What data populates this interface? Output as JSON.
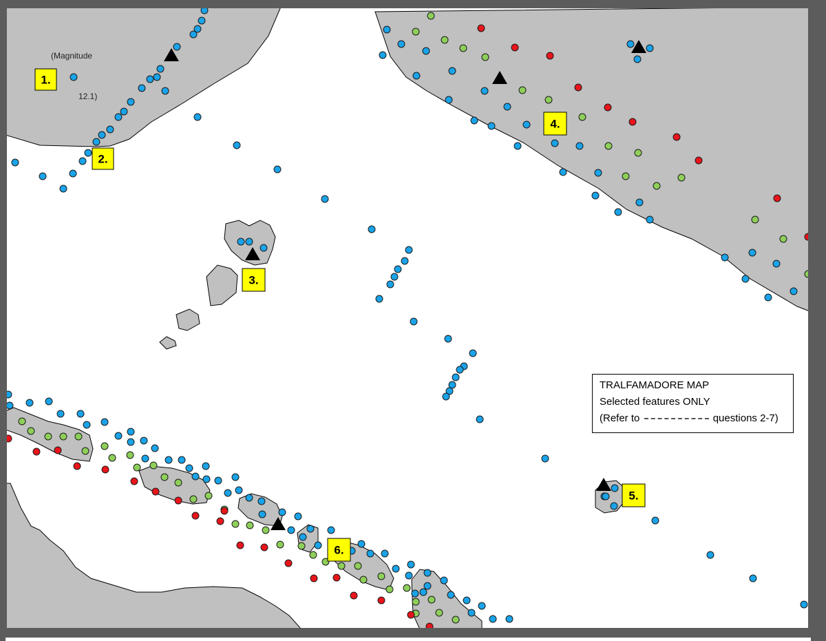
{
  "map": {
    "legend": {
      "title": "TRALFAMADORE MAP",
      "subtitle": "Selected features ONLY",
      "note_prefix": "(Refer to",
      "note_suffix": "questions 2-7)"
    },
    "magnitude_note": {
      "line1": "(Magnitude",
      "line2": "12.1)"
    },
    "labels": [
      "1.",
      "2.",
      "3.",
      "4.",
      "5.",
      "6."
    ],
    "colors": {
      "land": "#c0c0c0",
      "water": "#ffffff",
      "blue_dot": "#1aa3e8",
      "green_dot": "#8ecf5a",
      "red_dot": "#e8151b",
      "label_box": "#ffff00",
      "volcano": "#000000"
    },
    "symbols": {
      "volcano": "black-triangle-icon",
      "blue_dot": "blue-circle-icon",
      "green_dot": "green-circle-icon",
      "red_dot": "red-circle-icon"
    }
  }
}
